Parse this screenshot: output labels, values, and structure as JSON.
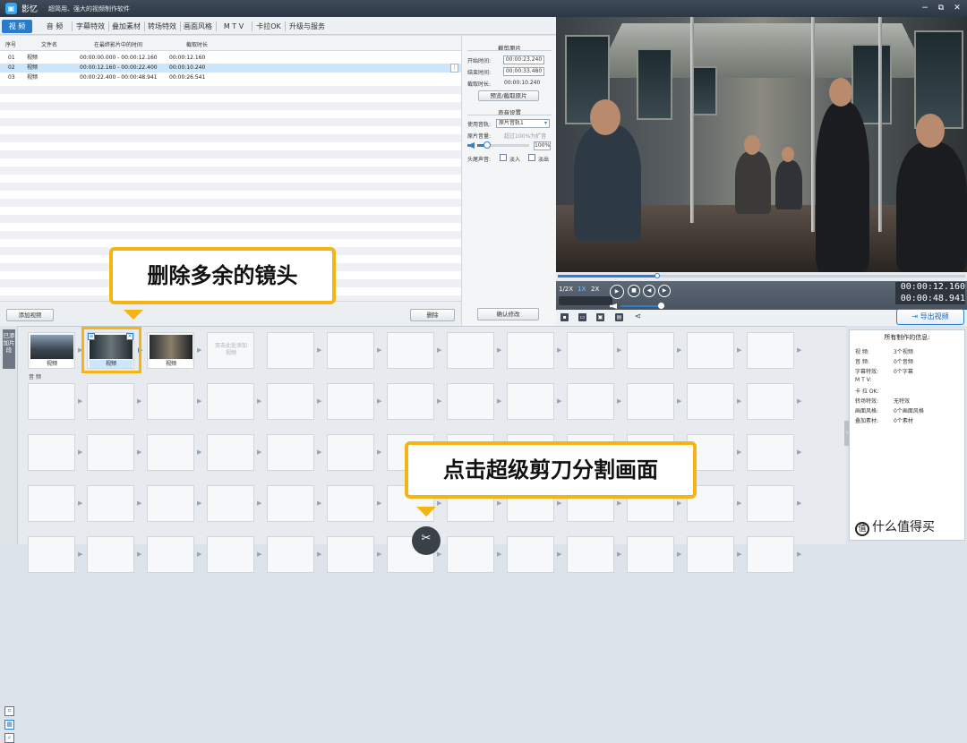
{
  "titlebar": {
    "app_name": "影忆",
    "slogan": "超简用、强大的视频制作软件",
    "min_icon": "−",
    "restore_icon": "⧉",
    "close_icon": "✕"
  },
  "tabs": [
    {
      "label": "视  频",
      "active": true
    },
    {
      "label": "音  频"
    },
    {
      "label": "字幕特效"
    },
    {
      "label": "叠加素材"
    },
    {
      "label": "转场特效"
    },
    {
      "label": "画面风格"
    },
    {
      "label": "M T V"
    },
    {
      "label": "卡拉OK"
    },
    {
      "label": "升级与服务"
    }
  ],
  "list": {
    "headers": [
      "序号",
      "文件名",
      "在最终影片中的时间",
      "截取时长"
    ],
    "rows": [
      {
        "no": "01",
        "name": "视频",
        "time": "00:00:00.000 - 00:00:12.160",
        "dur": "00:00:12.160"
      },
      {
        "no": "02",
        "name": "视频",
        "time": "00:00:12.160 - 00:00:22.400",
        "dur": "00:00:10.240",
        "selected": true
      },
      {
        "no": "03",
        "name": "视频",
        "time": "00:00:22.400 - 00:00:48.941",
        "dur": "00:00:26.541"
      }
    ],
    "row_menu": "⋮",
    "add_button": "添加视频",
    "delete_button": "删除",
    "confirm_button": "确认修改"
  },
  "settings": {
    "clip_header": "截剪原片",
    "start_label": "开始时间:",
    "start_value": "00:00:23.240",
    "end_label": "结束时间:",
    "end_value": "00:00:33.480",
    "dur_label": "截取时长:",
    "dur_value": "00:00:10.240",
    "preview_button": "预览/截取原片",
    "audio_header": "声音设置",
    "track_label": "使用音轨:",
    "track_value": "原片音轨1",
    "volume_label": "原片音量:",
    "volume_hint": "超过100%为扩音",
    "volume_value": "100%",
    "fade_label": "头尾声音:",
    "fade_in": "淡入",
    "fade_out": "淡出"
  },
  "player": {
    "speeds": [
      "1/2X",
      "1X",
      "2X"
    ],
    "current_time": "00:00:12.160",
    "total_time": "00:00:48.941",
    "export_button": "导出视频",
    "progress": 0.245
  },
  "timeline": {
    "tab_label": "已添加片段",
    "clips": [
      {
        "caption": "视频"
      },
      {
        "caption": "视频"
      },
      {
        "caption": "视频"
      }
    ],
    "placeholder": "双击此处添加视频",
    "audio_track_label": "音 频"
  },
  "info": {
    "title": "所有制作的信息:",
    "rows": [
      {
        "k": "视    频:",
        "v": "3个视频"
      },
      {
        "k": "音    频:",
        "v": "0个音频"
      },
      {
        "k": "字幕特效:",
        "v": "0个字幕"
      },
      {
        "k": "M  T  V:",
        "v": ""
      },
      {
        "k": "卡  拉 OK:",
        "v": ""
      },
      {
        "k": "转场特效:",
        "v": "无特效"
      },
      {
        "k": "画面风格:",
        "v": "0个画面风格"
      },
      {
        "k": "叠加素材:",
        "v": "0个素材"
      }
    ]
  },
  "callouts": {
    "delete_tip": "删除多余的镜头",
    "scissors_tip": "点击超级剪刀分割画面"
  },
  "watermark": "什么值得买",
  "colors": {
    "accent": "#2a7ccb",
    "highlight": "#f3b414"
  }
}
